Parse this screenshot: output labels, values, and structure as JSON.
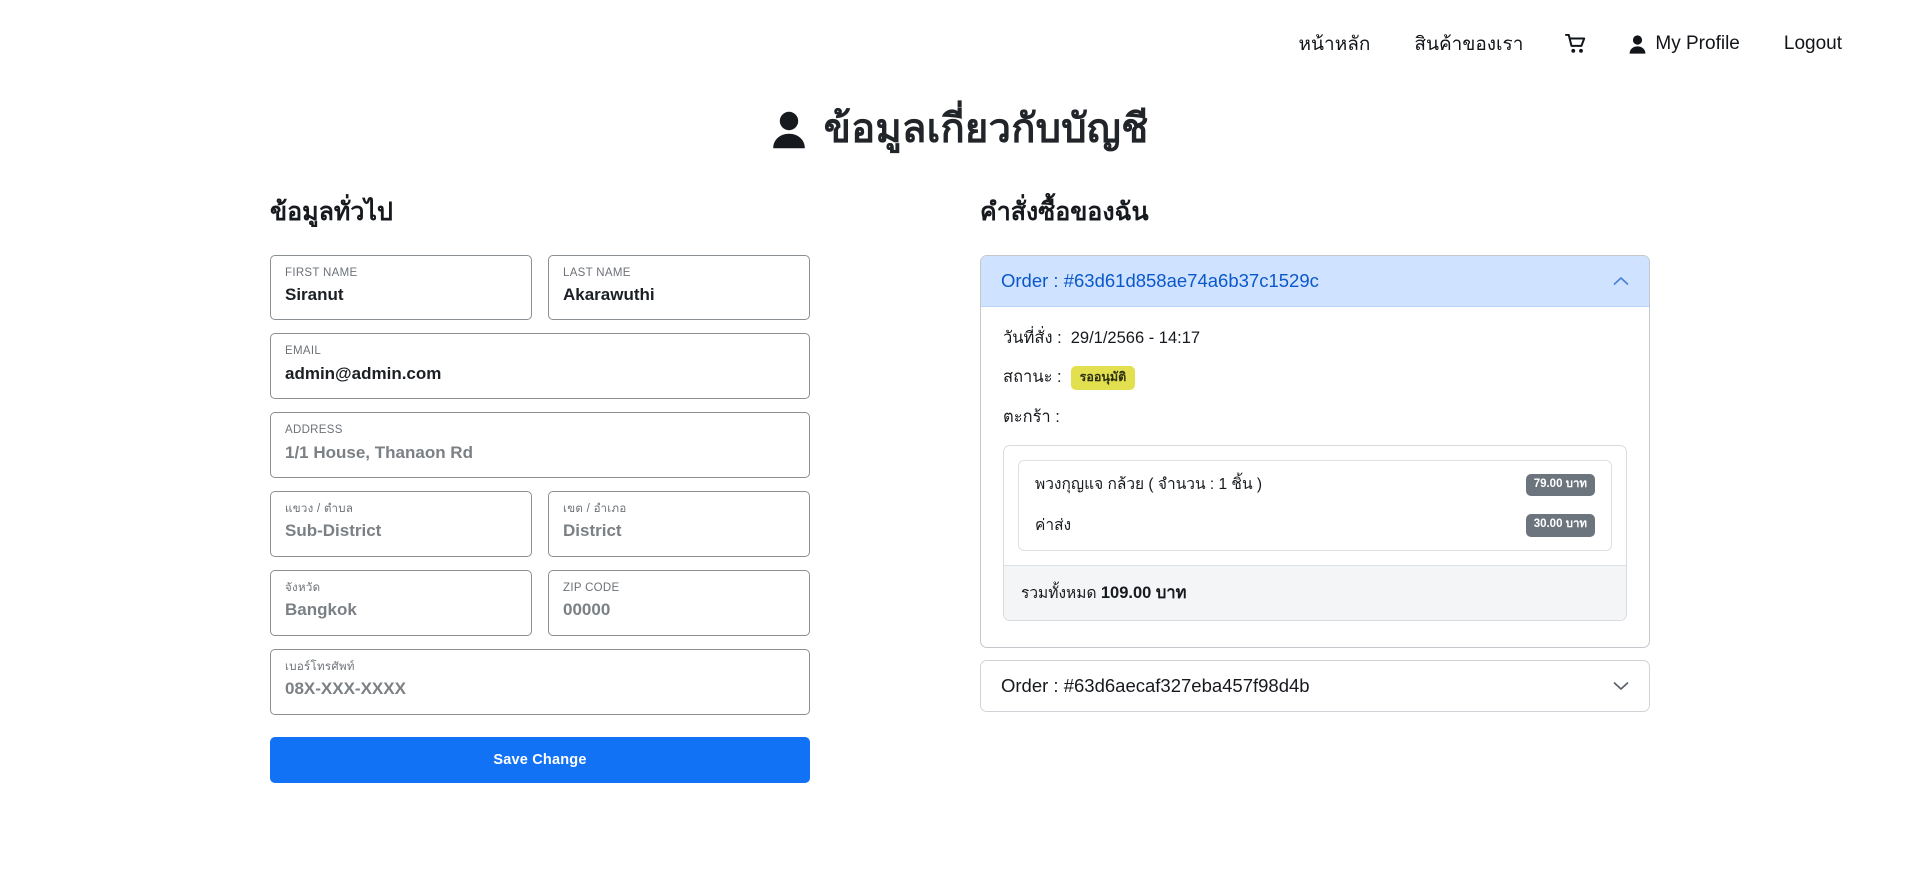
{
  "nav": {
    "items": [
      {
        "label": "หน้าหลัก",
        "icon": null,
        "name": "nav-home"
      },
      {
        "label": "สินค้าของเรา",
        "icon": null,
        "name": "nav-products"
      },
      {
        "label": "",
        "icon": "cart-icon",
        "name": "nav-cart"
      },
      {
        "label": "My Profile",
        "icon": "user-icon",
        "name": "nav-my-profile"
      },
      {
        "label": "Logout",
        "icon": null,
        "name": "nav-logout"
      }
    ]
  },
  "page": {
    "title": "ข้อมูลเกี่ยวกับบัญชี",
    "title_icon": "user-icon"
  },
  "general_info": {
    "heading": "ข้อมูลทั่วไป",
    "fields": [
      {
        "label": "FIRST NAME",
        "value": "Siranut",
        "is_placeholder": false
      },
      {
        "label": "LAST NAME",
        "value": "Akarawuthi",
        "is_placeholder": false
      },
      {
        "label": "EMAIL",
        "value": "admin@admin.com",
        "is_placeholder": false
      },
      {
        "label": "ADDRESS",
        "value": "1/1 House, Thanaon Rd",
        "is_placeholder": true
      },
      {
        "label": "แขวง / ตำบล",
        "value": "Sub-District",
        "is_placeholder": true
      },
      {
        "label": "เขต / อำเภอ",
        "value": "District",
        "is_placeholder": true
      },
      {
        "label": "จังหวัด",
        "value": "Bangkok",
        "is_placeholder": true
      },
      {
        "label": "ZIP CODE",
        "value": "00000",
        "is_placeholder": true
      },
      {
        "label": "เบอร์โทรศัพท์",
        "value": "08X-XXX-XXXX",
        "is_placeholder": true
      }
    ],
    "save_label": "Save Change"
  },
  "orders": {
    "heading": "คำสั่งซื้อของฉัน",
    "items": [
      {
        "title": "Order : #63d61d858ae74a6b37c1529c",
        "expanded": true,
        "chevron": "chevron-up-icon",
        "date_label": "วันที่สั่ง :",
        "date_value": "29/1/2566 - 14:17",
        "status_label": "สถานะ :",
        "status_value": "รออนุมัติ",
        "cart_label": "ตะกร้า :",
        "cart_rows": [
          {
            "name": "พวงกุญแจ กล้วย ( จำนวน : 1 ชิ้น )",
            "price": "79.00 บาท"
          },
          {
            "name": "ค่าส่ง",
            "price": "30.00 บาท"
          }
        ],
        "total_label": "รวมทั้งหมด",
        "total_value": "109.00 บาท"
      },
      {
        "title": "Order : #63d6aecaf327eba457f98d4b",
        "expanded": false,
        "chevron": "chevron-down-icon"
      }
    ]
  },
  "colors": {
    "primary": "#1272f5",
    "accordion_open_bg": "#cfe2ff",
    "accordion_open_text": "#0a58ca",
    "status_badge": "#e3e04f",
    "price_badge": "#6c757d"
  }
}
